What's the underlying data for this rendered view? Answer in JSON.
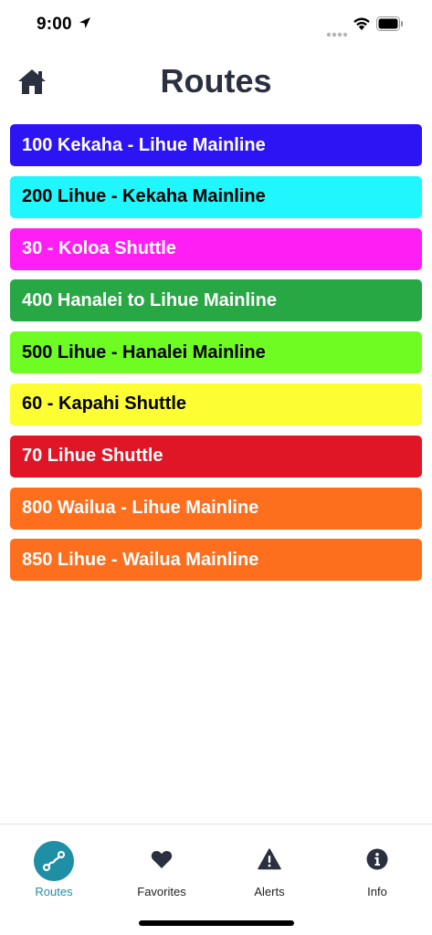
{
  "status": {
    "time": "9:00"
  },
  "header": {
    "title": "Routes",
    "home_icon": "home-icon"
  },
  "routes": [
    {
      "label": "100 Kekaha - Lihue Mainline",
      "color": "#2c14f5",
      "text_color": "#ffffff"
    },
    {
      "label": "200 Lihue - Kekaha Mainline",
      "color": "#1ff6fd",
      "text_color": "#000000"
    },
    {
      "label": "30 - Koloa Shuttle",
      "color": "#ff1ff5",
      "text_color": "#ffffff"
    },
    {
      "label": "400 Hanalei to Lihue Mainline",
      "color": "#28a745",
      "text_color": "#ffffff"
    },
    {
      "label": "500 Lihue - Hanalei Mainline",
      "color": "#6efc23",
      "text_color": "#000000"
    },
    {
      "label": "60 - Kapahi Shuttle",
      "color": "#fdfd34",
      "text_color": "#000000"
    },
    {
      "label": "70 Lihue Shuttle",
      "color": "#e01526",
      "text_color": "#ffffff"
    },
    {
      "label": "800 Wailua - Lihue Mainline",
      "color": "#fd6e1d",
      "text_color": "#ffffff"
    },
    {
      "label": "850 Lihue - Wailua Mainline",
      "color": "#fd6e1d",
      "text_color": "#ffffff"
    }
  ],
  "tabs": [
    {
      "label": "Routes",
      "icon": "route-icon",
      "active": true
    },
    {
      "label": "Favorites",
      "icon": "heart-icon",
      "active": false
    },
    {
      "label": "Alerts",
      "icon": "alert-icon",
      "active": false
    },
    {
      "label": "Info",
      "icon": "info-icon",
      "active": false
    }
  ],
  "colors": {
    "accent": "#1f8fa6",
    "title": "#2b3040"
  }
}
